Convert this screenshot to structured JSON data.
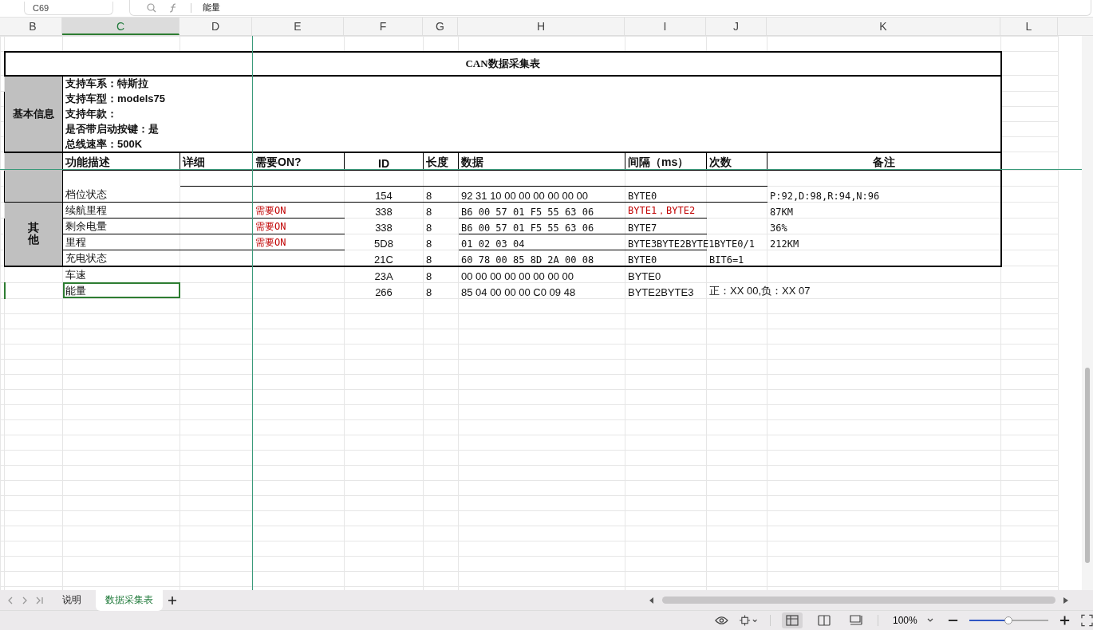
{
  "name_box": "C69",
  "formula": "能量",
  "columns": [
    {
      "label": "B",
      "selected": false
    },
    {
      "label": "C",
      "selected": true
    },
    {
      "label": "D",
      "selected": false
    },
    {
      "label": "E",
      "selected": false
    },
    {
      "label": "F",
      "selected": false
    },
    {
      "label": "G",
      "selected": false
    },
    {
      "label": "H",
      "selected": false
    },
    {
      "label": "I",
      "selected": false
    },
    {
      "label": "J",
      "selected": false
    },
    {
      "label": "K",
      "selected": false
    },
    {
      "label": "L",
      "selected": false
    }
  ],
  "title": "CAN数据采集表",
  "basic_info": {
    "label": "基本信息",
    "lines": [
      "支持车系：特斯拉",
      "支持车型：models75",
      "支持年款：",
      "是否带启动按键：是",
      "总线速率：500K"
    ]
  },
  "header": [
    "功能描述",
    "详细",
    "需要ON?",
    "ID",
    "长度",
    "数据",
    "间隔（ms）",
    "次数",
    "备注"
  ],
  "rows_top": [
    {
      "kind": "split",
      "function": "档位状态",
      "id": "154",
      "length": "8",
      "data": "92 31 10 00 00 00 00 00 00",
      "interval": "BYTE0",
      "interval_highlight": false,
      "note": "P:92,D:98,R:94,N:96",
      "selected": false
    }
  ],
  "group": {
    "label": "其他",
    "rows": [
      {
        "kind": "plain",
        "function": "续航里程",
        "need_on": "需要ON",
        "id": "338",
        "length": "8",
        "data": "B6  00  57  01  F5  55  63  06",
        "interval": "BYTE1，BYTE2",
        "interval_highlight": true,
        "note": "87KM",
        "selected": false
      },
      {
        "kind": "plain",
        "function": "剩余电量",
        "need_on": "需要ON",
        "id": "338",
        "length": "8",
        "data": "B6  00  57  01  F5  55  63  06",
        "interval": "BYTE7",
        "interval_highlight": false,
        "note": "36%",
        "selected": false
      },
      {
        "kind": "plain",
        "function": "里程",
        "need_on": "需要ON",
        "id": "5D8",
        "length": "8",
        "data": "01  02  03  04",
        "interval": "BYTE3BYTE2BYTE1BYTE0/1",
        "interval_highlight": false,
        "note": "212KM",
        "selected": false
      },
      {
        "kind": "plain",
        "function": "充电状态",
        "id": "21C",
        "length": "8",
        "data": "60  78  00  85  8D  2A  00  08",
        "interval": "BYTE0",
        "interval_highlight": false,
        "count": "BIT6=1",
        "selected": false
      }
    ]
  },
  "rows_after": [
    {
      "kind": "plain",
      "function": "车速",
      "id": "23A",
      "length": "8",
      "data": "00  00  00  00  00  00  00  00",
      "interval": "BYTE0",
      "interval_highlight": false,
      "selected": false
    },
    {
      "kind": "plain",
      "function": "能量",
      "id": "266",
      "length": "8",
      "data": "85  04  00  00  00  C0  09  48",
      "interval": "BYTE2BYTE3",
      "interval_highlight": false,
      "count": "正：XX 00,负：XX 07",
      "selected": true
    }
  ],
  "sheet_tabs": [
    {
      "label": "说明",
      "selected": false
    },
    {
      "label": "数据采集表",
      "selected": true
    }
  ],
  "views": [
    {
      "selected": true
    },
    {
      "selected": false
    },
    {
      "selected": false
    }
  ],
  "zoom": {
    "label": "100%",
    "level": 0.5
  }
}
